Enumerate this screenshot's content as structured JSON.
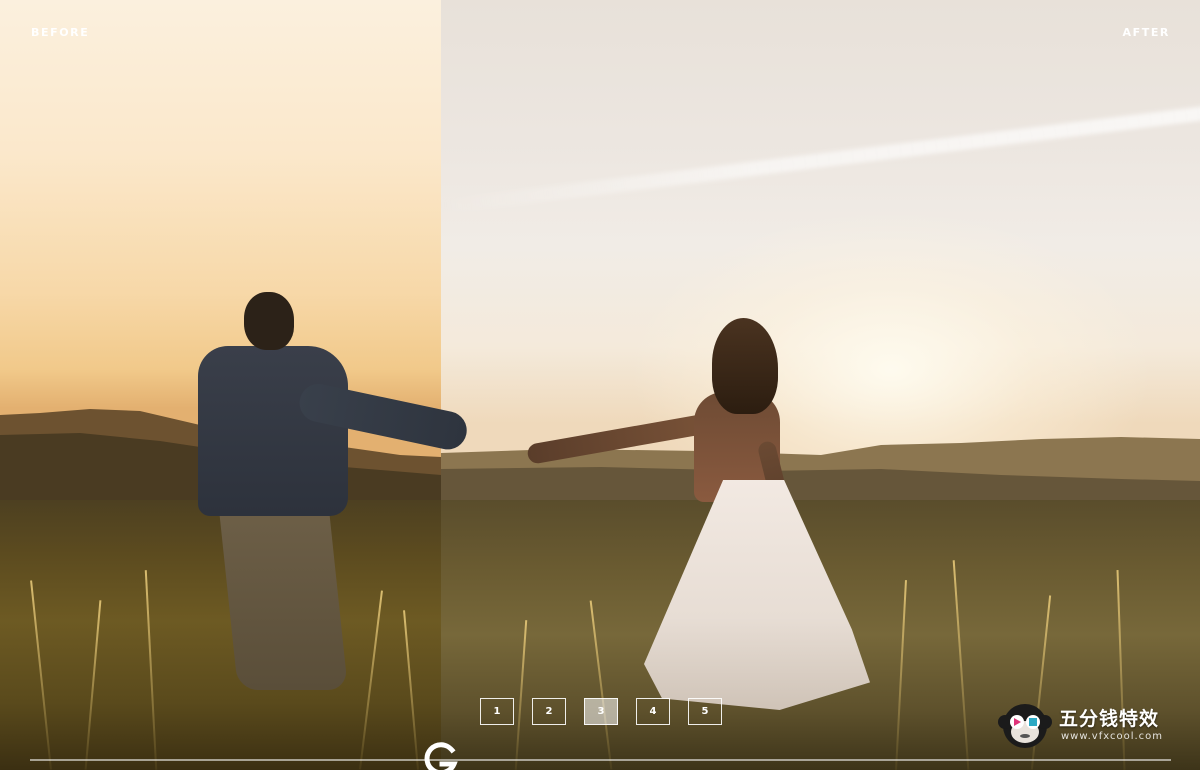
{
  "compare": {
    "before_label": "BEFORE",
    "after_label": "AFTER",
    "split_position": 0.368
  },
  "pager": {
    "pages": [
      "1",
      "2",
      "3",
      "4",
      "5"
    ],
    "active_index": 2
  },
  "slider": {
    "handle_icon": "g-logo-icon"
  },
  "watermark": {
    "title": "五分钱特效",
    "url": "www.vfxcool.com"
  },
  "colors": {
    "label": "#ffffff",
    "active_page_bg": "#c8c2bb",
    "track": "#ffffff"
  }
}
